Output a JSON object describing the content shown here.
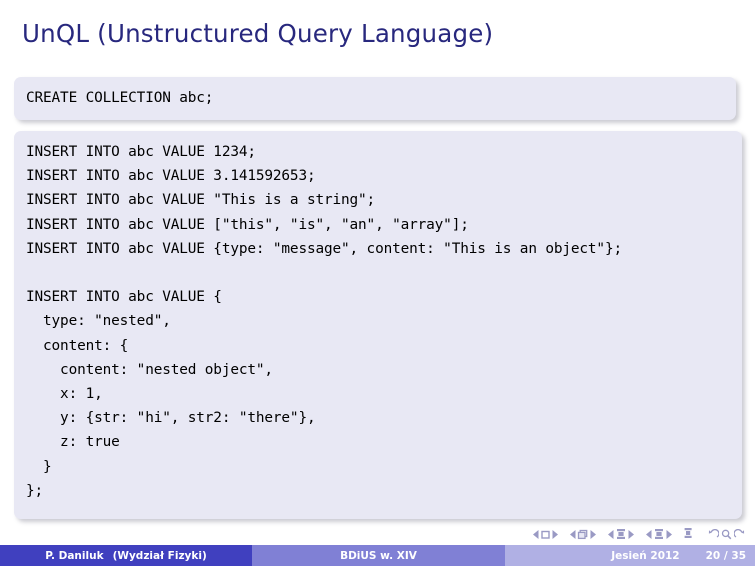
{
  "slide": {
    "title": "UnQL (Unstructured Query Language)"
  },
  "code_blocks": [
    {
      "name": "create-collection",
      "lines": [
        "CREATE COLLECTION abc;"
      ]
    },
    {
      "name": "insert-statements",
      "lines": [
        "INSERT INTO abc VALUE 1234;",
        "INSERT INTO abc VALUE 3.141592653;",
        "INSERT INTO abc VALUE \"This is a string\";",
        "INSERT INTO abc VALUE [\"this\", \"is\", \"an\", \"array\"];",
        "INSERT INTO abc VALUE {type: \"message\", content: \"This is an object\"};",
        "",
        "INSERT INTO abc VALUE {",
        "  type: \"nested\",",
        "  content: {",
        "    content: \"nested object\",",
        "    x: 1,",
        "    y: {str: \"hi\", str2: \"there\"},",
        "    z: true",
        "  }",
        "};"
      ]
    }
  ],
  "navigation": {
    "symbols": [
      "first-frame-icon",
      "prev-frame-icon",
      "next-frame-icon",
      "last-frame-icon",
      "first-subsection-icon",
      "prev-subsection-icon",
      "next-subsection-icon",
      "last-subsection-icon",
      "first-section-icon",
      "prev-section-icon",
      "next-section-icon",
      "last-section-icon",
      "doc-icon",
      "back-icon",
      "search-icon",
      "forward-icon"
    ]
  },
  "footer": {
    "author": "P. Daniluk",
    "institute": "(Wydział Fizyki)",
    "short_title": "BDiUS w. XIV",
    "date": "Jesień 2012",
    "page": "20 / 35"
  },
  "colors": {
    "title_text": "#28287e",
    "code_background": "#e8e8f4",
    "footer_left": "#4040bf",
    "footer_middle": "#8080d5",
    "footer_right": "#b0b0e4",
    "nav_symbols": "#9a9ac4"
  }
}
